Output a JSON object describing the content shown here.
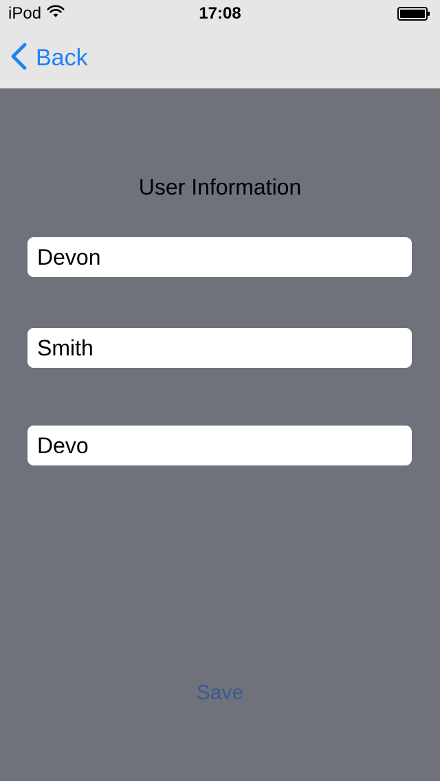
{
  "status_bar": {
    "device": "iPod",
    "time": "17:08",
    "wifi_icon": "wifi-icon",
    "battery_icon": "battery-icon"
  },
  "nav": {
    "back_label": "Back",
    "back_icon": "chevron-left-icon",
    "accent_color": "#1e82f5"
  },
  "form": {
    "title": "User Information",
    "first_name": "Devon",
    "last_name": "Smith",
    "username": "Devo"
  },
  "actions": {
    "save_label": "Save"
  }
}
